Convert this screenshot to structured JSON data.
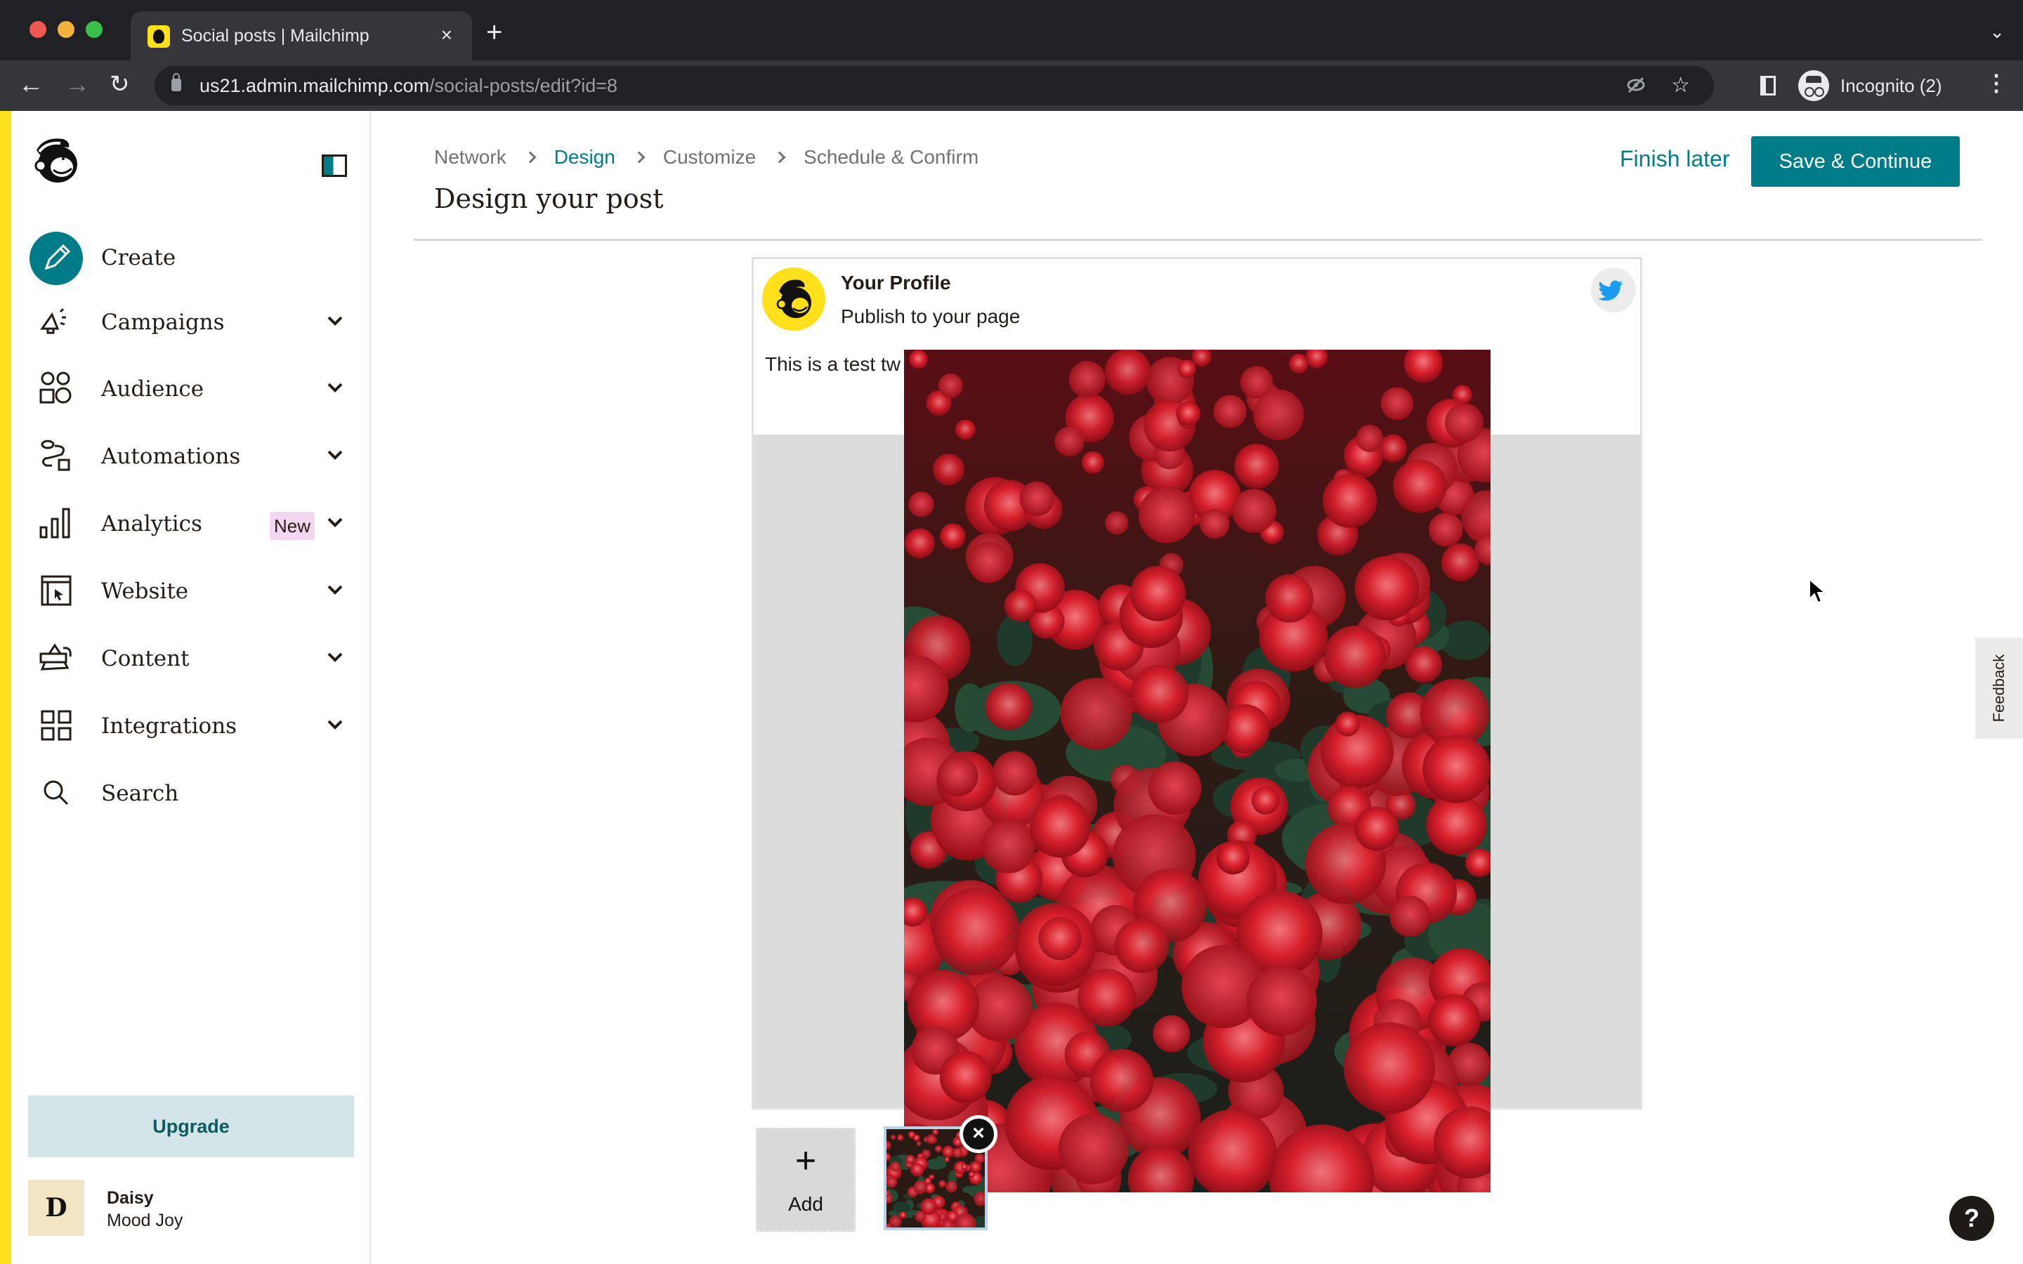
{
  "browser": {
    "tab_title": "Social posts | Mailchimp",
    "tab_close": "×",
    "new_tab": "+",
    "tab_search": "⌄",
    "nav_back": "←",
    "nav_forward": "→",
    "nav_reload": "↻",
    "url_host": "us21.admin.mailchimp.com",
    "url_path": "/social-posts/edit?id=8",
    "eye_off": "◌",
    "star": "☆",
    "incognito_label": "Incognito (2)",
    "menu": "⋮"
  },
  "sidebar": {
    "items": [
      {
        "label": "Create",
        "icon": "pencil-icon",
        "expandable": false
      },
      {
        "label": "Campaigns",
        "icon": "megaphone-icon",
        "expandable": true
      },
      {
        "label": "Audience",
        "icon": "audience-icon",
        "expandable": true
      },
      {
        "label": "Automations",
        "icon": "automations-icon",
        "expandable": true
      },
      {
        "label": "Analytics",
        "icon": "bar-chart-icon",
        "expandable": true,
        "badge": "New"
      },
      {
        "label": "Website",
        "icon": "website-icon",
        "expandable": true
      },
      {
        "label": "Content",
        "icon": "content-icon",
        "expandable": true
      },
      {
        "label": "Integrations",
        "icon": "grid-icon",
        "expandable": true
      },
      {
        "label": "Search",
        "icon": "search-icon",
        "expandable": false
      }
    ],
    "upgrade_label": "Upgrade",
    "user": {
      "initial": "D",
      "name": "Daisy",
      "org": "Mood Joy"
    }
  },
  "header": {
    "breadcrumb": [
      {
        "label": "Network",
        "active": false
      },
      {
        "label": "Design",
        "active": true
      },
      {
        "label": "Customize",
        "active": false
      },
      {
        "label": "Schedule & Confirm",
        "active": false
      }
    ],
    "title": "Design your post",
    "finish_later": "Finish later",
    "save_continue": "Save & Continue"
  },
  "post": {
    "profile_name": "Your Profile",
    "profile_sub": "Publish to your page",
    "network": "Twitter",
    "text_visible": "This is a test tw"
  },
  "media": {
    "add_label": "Add",
    "add_icon": "+",
    "remove_icon": "×"
  },
  "feedback_label": "Feedback",
  "help_label": "?",
  "colors": {
    "brand_yellow": "#ffe01b",
    "accent_teal": "#007c89",
    "upgrade_bg": "#d3e5e7",
    "badge_new_bg": "#f5d6f0",
    "twitter_blue": "#1d9bf0"
  }
}
